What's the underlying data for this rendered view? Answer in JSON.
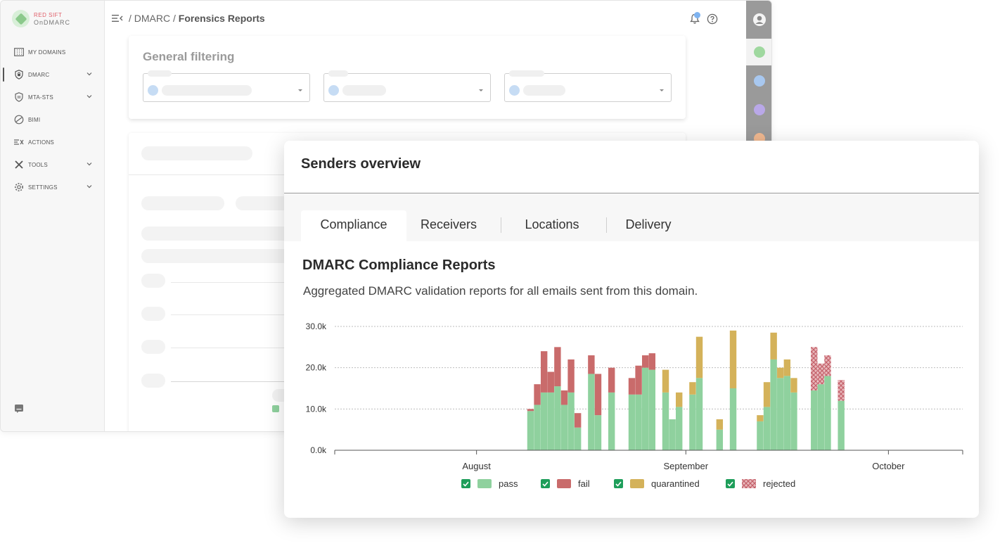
{
  "app": {
    "logo": {
      "brand": "RED SIFT",
      "product": "OnDMARC"
    },
    "nav": [
      {
        "label": "MY DOMAINS",
        "icon": "building-icon",
        "chevron": false
      },
      {
        "label": "DMARC",
        "icon": "lock-shield-icon",
        "chevron": true,
        "active": true
      },
      {
        "label": "MTA-STS",
        "icon": "shield-icon",
        "chevron": true
      },
      {
        "label": "BIMI",
        "icon": "bimi-icon",
        "chevron": false
      },
      {
        "label": "ACTIONS",
        "icon": "actions-icon",
        "chevron": false
      },
      {
        "label": "TOOLS",
        "icon": "tools-icon",
        "chevron": true
      },
      {
        "label": "SETTINGS",
        "icon": "gear-icon",
        "chevron": true
      }
    ],
    "breadcrumb": {
      "sep": "/",
      "parent": "DMARC",
      "current": "Forensics Reports"
    },
    "filter_title": "General filtering"
  },
  "panel": {
    "title": "Senders overview",
    "tabs": [
      "Compliance",
      "Receivers",
      "Locations",
      "Delivery"
    ],
    "active_tab": 0,
    "chart_title": "DMARC Compliance Reports",
    "chart_subtitle": "Aggregated DMARC validation reports for all emails sent from this domain."
  },
  "colors": {
    "pass": "#8fd19e",
    "fail": "#c96b6b",
    "quarantined": "#d4b25a",
    "rejected": "#d9858c",
    "check": "#1e9e5a"
  },
  "chart_data": {
    "type": "bar",
    "stacked": true,
    "x_range": [
      "2023-07-11",
      "2023-10-12"
    ],
    "x_ticks": [
      {
        "label": "August",
        "date": "2023-08-01"
      },
      {
        "label": "September",
        "date": "2023-09-01"
      },
      {
        "label": "October",
        "date": "2023-10-01"
      }
    ],
    "y_ticks": [
      "0.0k",
      "10.0k",
      "20.0k",
      "30.0k"
    ],
    "ylim": [
      0,
      30000
    ],
    "grid": true,
    "legend_position": "bottom",
    "series_names": [
      "pass",
      "fail",
      "quarantined",
      "rejected"
    ],
    "bars": [
      {
        "date": "2023-08-09",
        "pass": 9500,
        "fail": 500,
        "quarantined": 0,
        "rejected": 0
      },
      {
        "date": "2023-08-10",
        "pass": 11000,
        "fail": 5000,
        "quarantined": 0,
        "rejected": 0
      },
      {
        "date": "2023-08-11",
        "pass": 14000,
        "fail": 10000,
        "quarantined": 0,
        "rejected": 0
      },
      {
        "date": "2023-08-12",
        "pass": 14000,
        "fail": 5000,
        "quarantined": 0,
        "rejected": 0
      },
      {
        "date": "2023-08-13",
        "pass": 15500,
        "fail": 9500,
        "quarantined": 0,
        "rejected": 0
      },
      {
        "date": "2023-08-14",
        "pass": 11000,
        "fail": 3500,
        "quarantined": 0,
        "rejected": 0
      },
      {
        "date": "2023-08-15",
        "pass": 14000,
        "fail": 8000,
        "quarantined": 0,
        "rejected": 0
      },
      {
        "date": "2023-08-16",
        "pass": 5500,
        "fail": 3500,
        "quarantined": 0,
        "rejected": 0
      },
      {
        "date": "2023-08-18",
        "pass": 18500,
        "fail": 4500,
        "quarantined": 0,
        "rejected": 0
      },
      {
        "date": "2023-08-19",
        "pass": 8500,
        "fail": 10000,
        "quarantined": 0,
        "rejected": 0
      },
      {
        "date": "2023-08-21",
        "pass": 14000,
        "fail": 6000,
        "quarantined": 0,
        "rejected": 0
      },
      {
        "date": "2023-08-24",
        "pass": 13500,
        "fail": 4000,
        "quarantined": 0,
        "rejected": 0
      },
      {
        "date": "2023-08-25",
        "pass": 13500,
        "fail": 7000,
        "quarantined": 0,
        "rejected": 0
      },
      {
        "date": "2023-08-26",
        "pass": 20000,
        "fail": 3000,
        "quarantined": 0,
        "rejected": 0
      },
      {
        "date": "2023-08-27",
        "pass": 19500,
        "fail": 4000,
        "quarantined": 0,
        "rejected": 0
      },
      {
        "date": "2023-08-29",
        "pass": 14000,
        "fail": 0,
        "quarantined": 5500,
        "rejected": 0
      },
      {
        "date": "2023-08-30",
        "pass": 7500,
        "fail": 0,
        "quarantined": 0,
        "rejected": 0
      },
      {
        "date": "2023-08-31",
        "pass": 10500,
        "fail": 0,
        "quarantined": 3500,
        "rejected": 0
      },
      {
        "date": "2023-09-02",
        "pass": 13500,
        "fail": 0,
        "quarantined": 3000,
        "rejected": 0
      },
      {
        "date": "2023-09-03",
        "pass": 17500,
        "fail": 0,
        "quarantined": 10000,
        "rejected": 0
      },
      {
        "date": "2023-09-06",
        "pass": 5000,
        "fail": 0,
        "quarantined": 2500,
        "rejected": 0
      },
      {
        "date": "2023-09-08",
        "pass": 15000,
        "fail": 0,
        "quarantined": 14000,
        "rejected": 0
      },
      {
        "date": "2023-09-12",
        "pass": 7000,
        "fail": 0,
        "quarantined": 1500,
        "rejected": 0
      },
      {
        "date": "2023-09-13",
        "pass": 10500,
        "fail": 0,
        "quarantined": 6000,
        "rejected": 0
      },
      {
        "date": "2023-09-14",
        "pass": 22000,
        "fail": 0,
        "quarantined": 6500,
        "rejected": 0
      },
      {
        "date": "2023-09-15",
        "pass": 17500,
        "fail": 0,
        "quarantined": 2500,
        "rejected": 0
      },
      {
        "date": "2023-09-16",
        "pass": 18000,
        "fail": 0,
        "quarantined": 4000,
        "rejected": 0
      },
      {
        "date": "2023-09-17",
        "pass": 14000,
        "fail": 0,
        "quarantined": 3500,
        "rejected": 0
      },
      {
        "date": "2023-09-20",
        "pass": 14500,
        "fail": 0,
        "quarantined": 0,
        "rejected": 10500
      },
      {
        "date": "2023-09-21",
        "pass": 16000,
        "fail": 0,
        "quarantined": 0,
        "rejected": 5000
      },
      {
        "date": "2023-09-22",
        "pass": 18000,
        "fail": 0,
        "quarantined": 0,
        "rejected": 5000
      },
      {
        "date": "2023-09-24",
        "pass": 12000,
        "fail": 0,
        "quarantined": 0,
        "rejected": 5000
      }
    ]
  }
}
